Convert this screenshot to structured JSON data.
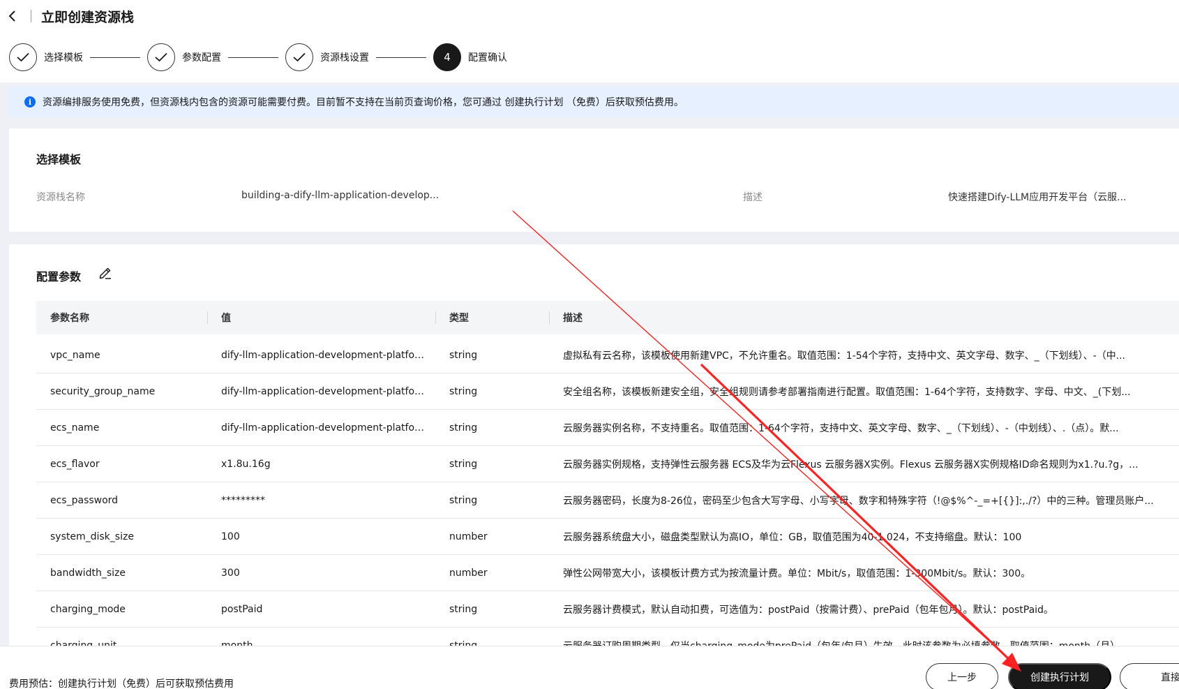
{
  "header": {
    "title": "立即创建资源栈"
  },
  "stepper": {
    "steps": [
      {
        "label": "选择模板",
        "state": "done"
      },
      {
        "label": "参数配置",
        "state": "done"
      },
      {
        "label": "资源栈设置",
        "state": "done"
      },
      {
        "label": "配置确认",
        "state": "active",
        "number": "4"
      }
    ]
  },
  "banner": {
    "text": "资源编排服务使用免费，但资源栈内包含的资源可能需要付费。目前暂不支持在当前页查询价格，您可通过 创建执行计划 （免费）后获取预估费用。"
  },
  "template_card": {
    "title": "选择模板",
    "stack_name_label": "资源栈名称",
    "stack_name_value": "building-a-dify-llm-application-develop...",
    "desc_label": "描述",
    "desc_value": "快速搭建Dify-LLM应用开发平台（云服..."
  },
  "params_card": {
    "title": "配置参数",
    "columns": [
      "参数名称",
      "值",
      "类型",
      "描述"
    ],
    "rows": [
      {
        "name": "vpc_name",
        "value": "dify-llm-application-development-platform-...",
        "type": "string",
        "desc": "虚拟私有云名称，该模板使用新建VPC，不允许重名。取值范围：1-54个字符，支持中文、英文字母、数字、_（下划线）、-（中..."
      },
      {
        "name": "security_group_name",
        "value": "dify-llm-application-development-platform-...",
        "type": "string",
        "desc": "安全组名称，该模板新建安全组，安全组规则请参考部署指南进行配置。取值范围：1-64个字符，支持数字、字母、中文、_(下划..."
      },
      {
        "name": "ecs_name",
        "value": "dify-llm-application-development-platform-...",
        "type": "string",
        "desc": "云服务器实例名称，不支持重名。取值范围：1-64个字符，支持中文、英文字母、数字、_（下划线）、-（中划线）、.（点）。默..."
      },
      {
        "name": "ecs_flavor",
        "value": "x1.8u.16g",
        "type": "string",
        "desc": "云服务器实例规格，支持弹性云服务器 ECS及华为云Flexus 云服务器X实例。Flexus 云服务器X实例规格ID命名规则为x1.?u.?g，..."
      },
      {
        "name": "ecs_password",
        "value": "*********",
        "type": "string",
        "desc": "云服务器密码，长度为8-26位，密码至少包含大写字母、小写字母、数字和特殊字符（!@$%^-_=+[{}]:,./?）中的三种。管理员账户..."
      },
      {
        "name": "system_disk_size",
        "value": "100",
        "type": "number",
        "desc": "云服务器系统盘大小，磁盘类型默认为高IO，单位：GB，取值范围为40-1,024，不支持缩盘。默认：100"
      },
      {
        "name": "bandwidth_size",
        "value": "300",
        "type": "number",
        "desc": "弹性公网带宽大小，该模板计费方式为按流量计费。单位：Mbit/s，取值范围：1-300Mbit/s。默认：300。"
      },
      {
        "name": "charging_mode",
        "value": "postPaid",
        "type": "string",
        "desc": "云服务器计费模式，默认自动扣费，可选值为：postPaid（按需计费）、prePaid（包年包月）。默认：postPaid。"
      },
      {
        "name": "charging_unit",
        "value": "month",
        "type": "string",
        "desc": "云服务器订购周期类型，仅当charging_mode为prePaid（包年/包月）生效，此时该参数为必填参数。取值范围：month（月）..."
      }
    ]
  },
  "footer": {
    "cost_text": "费用预估：创建执行计划（免费）后可获取预估费用",
    "prev_label": "上一步",
    "plan_label": "创建执行计划",
    "deploy_label": "直接部署"
  },
  "colors": {
    "primary": "#191919",
    "info_bg": "#e6f0ff",
    "info_icon": "#0b6ef5",
    "annotation_arrow": "#ff0000"
  }
}
